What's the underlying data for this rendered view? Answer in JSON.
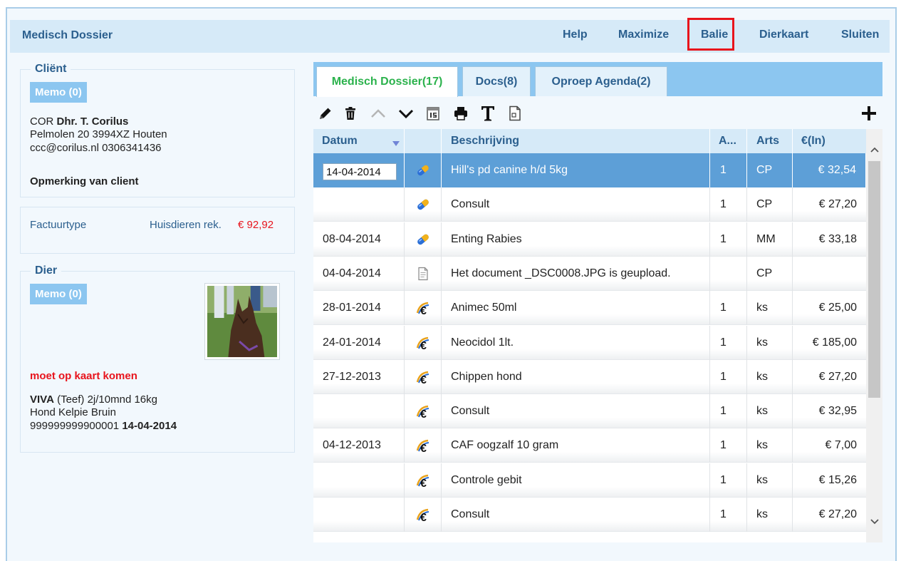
{
  "app": {
    "title": "Medisch Dossier",
    "menu": [
      "Help",
      "Maximize",
      "Balie",
      "Dierkaart",
      "Sluiten"
    ],
    "highlight_color": "#e8141c"
  },
  "client": {
    "legend": "Cliënt",
    "memo": "Memo (0)",
    "code": "COR",
    "name": "Dhr. T. Corilus",
    "address": "Pelmolen 20 3994XZ Houten",
    "contact": "ccc@corilus.nl 0306341436",
    "remark": "Opmerking van client"
  },
  "invoice": {
    "label": "Factuurtype",
    "type": "Huisdieren rek.",
    "amount": "€ 92,92"
  },
  "animal": {
    "legend": "Dier",
    "memo": "Memo (0)",
    "alert": "moet op kaart komen",
    "name": "VIVA",
    "details": "(Teef) 2j/10mnd 16kg",
    "breed": "Hond Kelpie Bruin",
    "chip": "999999999900001",
    "date": "14-04-2014"
  },
  "tabs": [
    {
      "label": "Medisch Dossier(17)",
      "active": true
    },
    {
      "label": "Docs(8)",
      "active": false
    },
    {
      "label": "Oproep Agenda(2)",
      "active": false
    }
  ],
  "toolbar_icons": [
    "pencil-icon",
    "trash-icon",
    "chevron-up-icon",
    "chevron-down-icon",
    "calendar-icon",
    "printer-icon",
    "text-icon",
    "document-icon",
    "plus-icon"
  ],
  "table": {
    "columns": [
      "Datum",
      "Beschrijving",
      "A...",
      "Arts",
      "€(In)"
    ],
    "rows": [
      {
        "date": "14-04-2014",
        "icon": "pill",
        "desc": "Hill's pd canine h/d 5kg",
        "a": "1",
        "arts": "CP",
        "eur": "€ 32,54",
        "selected": true
      },
      {
        "date": "",
        "icon": "pill",
        "desc": "Consult",
        "a": "1",
        "arts": "CP",
        "eur": "€ 27,20"
      },
      {
        "date": "08-04-2014",
        "icon": "pill",
        "desc": "Enting Rabies",
        "a": "1",
        "arts": "MM",
        "eur": "€ 33,18"
      },
      {
        "date": "04-04-2014",
        "icon": "doc",
        "desc": "Het document _DSC0008.JPG is geupload.",
        "a": "",
        "arts": "CP",
        "eur": ""
      },
      {
        "date": "28-01-2014",
        "icon": "euro",
        "desc": "Animec 50ml",
        "a": "1",
        "arts": "ks",
        "eur": "€ 25,00"
      },
      {
        "date": "24-01-2014",
        "icon": "euro",
        "desc": "Neocidol 1lt.",
        "a": "1",
        "arts": "ks",
        "eur": "€ 185,00"
      },
      {
        "date": "27-12-2013",
        "icon": "euro",
        "desc": "Chippen hond",
        "a": "1",
        "arts": "ks",
        "eur": "€ 27,20"
      },
      {
        "date": "",
        "icon": "euro",
        "desc": "Consult",
        "a": "1",
        "arts": "ks",
        "eur": "€ 32,95"
      },
      {
        "date": "04-12-2013",
        "icon": "euro",
        "desc": "CAF oogzalf 10 gram",
        "a": "1",
        "arts": "ks",
        "eur": "€ 7,00"
      },
      {
        "date": "",
        "icon": "euro",
        "desc": "Controle gebit",
        "a": "1",
        "arts": "ks",
        "eur": "€ 15,26"
      },
      {
        "date": "",
        "icon": "euro",
        "desc": "Consult",
        "a": "1",
        "arts": "ks",
        "eur": "€ 27,20"
      }
    ]
  }
}
